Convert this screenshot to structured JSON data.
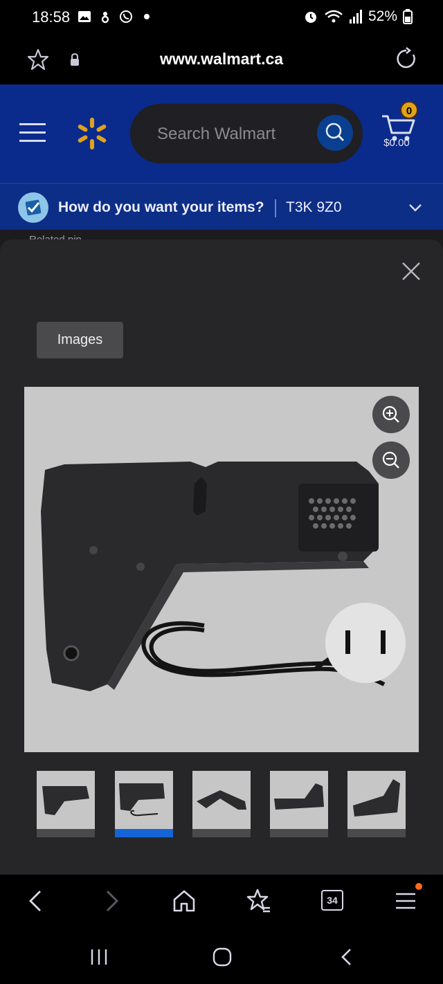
{
  "status_bar": {
    "time": "18:58",
    "battery": "52%",
    "icons": [
      "gallery-icon",
      "hotspot-icon",
      "viber-icon",
      "dot-icon",
      "alarm-icon",
      "wifi-icon",
      "signal-icon",
      "battery-icon"
    ]
  },
  "browser": {
    "url": "www.walmart.ca",
    "icons": [
      "bookmark-star-icon",
      "lock-icon",
      "reload-icon"
    ]
  },
  "header": {
    "search_placeholder": "Search Walmart",
    "cart_count": "0",
    "cart_total": "$0.00",
    "colors": {
      "header_bg": "#0a2a8c",
      "spark": "#e0a11b"
    }
  },
  "fulfillment": {
    "question": "How do you want your items?",
    "postal_code": "T3K 9Z0"
  },
  "behind_content": {
    "partial_text": "Related pin"
  },
  "modal": {
    "tab_label": "Images",
    "thumbnail_count": 5,
    "selected_thumbnail": 2,
    "colors": {
      "selected": "#1565d8"
    }
  },
  "bottom_nav": {
    "tab_count": "34",
    "icons": [
      "back-icon",
      "forward-icon",
      "home-icon",
      "bookmarks-icon",
      "tabs-icon",
      "menu-icon"
    ]
  },
  "system_nav": {
    "icons": [
      "recents-icon",
      "home-circle-icon",
      "system-back-icon"
    ]
  }
}
